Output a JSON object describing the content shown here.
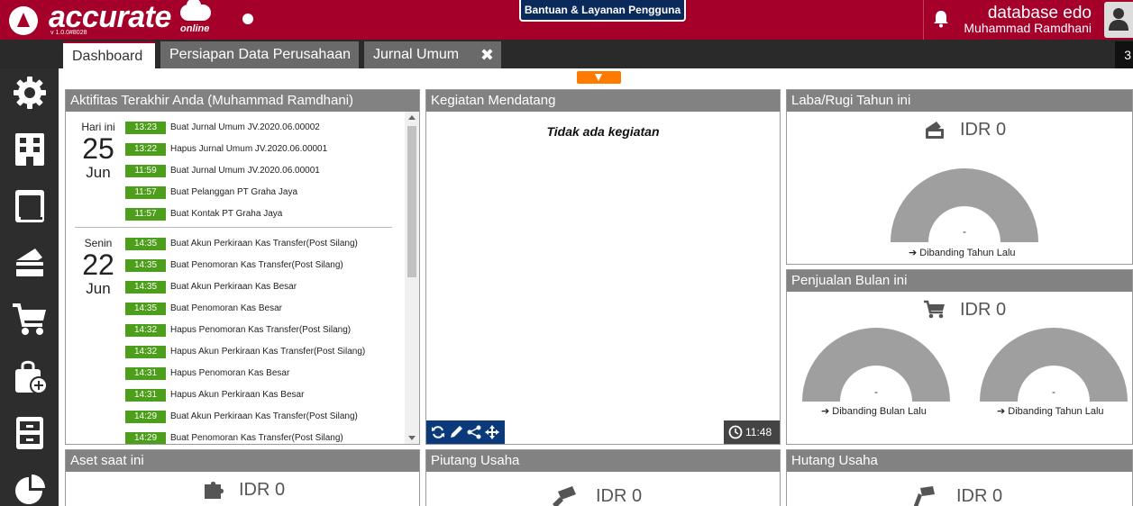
{
  "header": {
    "logo_text": "accurate",
    "logo_online": "online",
    "version": "v 1.0.0#8028",
    "help_button": "Bantuan & Layanan Pengguna",
    "database": "database edo",
    "user": "Muhammad Ramdhani"
  },
  "tabs": [
    {
      "label": "Dashboard",
      "active": true
    },
    {
      "label": "Persiapan Data Perusahaan",
      "active": false
    },
    {
      "label": "Jurnal Umum",
      "active": false,
      "closable": true
    }
  ],
  "tab_overflow": "3",
  "sidebar": {
    "items": [
      {
        "icon": "gear-icon"
      },
      {
        "icon": "building-icon"
      },
      {
        "icon": "book-icon"
      },
      {
        "icon": "payment-icon"
      },
      {
        "icon": "cart-icon"
      },
      {
        "icon": "shopping-bag-add-icon"
      },
      {
        "icon": "inventory-box-icon"
      },
      {
        "icon": "pie-chart-icon"
      }
    ]
  },
  "activity": {
    "title": "Aktifitas Terakhir Anda (Muhammad Ramdhani)",
    "days": [
      {
        "label": "Hari ini",
        "day": "25",
        "month": "Jun",
        "items": [
          {
            "time": "13:23",
            "text": "Buat Jurnal Umum JV.2020.06.00002"
          },
          {
            "time": "13:22",
            "text": "Hapus Jurnal Umum JV.2020.06.00001"
          },
          {
            "time": "11:59",
            "text": "Buat Jurnal Umum JV.2020.06.00001"
          },
          {
            "time": "11:57",
            "text": "Buat Pelanggan PT Graha Jaya"
          },
          {
            "time": "11:57",
            "text": "Buat Kontak PT Graha Jaya"
          }
        ]
      },
      {
        "label": "Senin",
        "day": "22",
        "month": "Jun",
        "items": [
          {
            "time": "14:35",
            "text": "Buat Akun Perkiraan Kas Transfer(Post Silang)"
          },
          {
            "time": "14:35",
            "text": "Buat Penomoran Kas Transfer(Post Silang)"
          },
          {
            "time": "14:35",
            "text": "Buat Akun Perkiraan Kas Besar"
          },
          {
            "time": "14:35",
            "text": "Buat Penomoran Kas Besar"
          },
          {
            "time": "14:32",
            "text": "Hapus Penomoran Kas Transfer(Post Silang)"
          },
          {
            "time": "14:32",
            "text": "Hapus Akun Perkiraan Kas Transfer(Post Silang)"
          },
          {
            "time": "14:31",
            "text": "Hapus Penomoran Kas Besar"
          },
          {
            "time": "14:31",
            "text": "Hapus Akun Perkiraan Kas Besar"
          },
          {
            "time": "14:29",
            "text": "Buat Akun Perkiraan Kas Transfer(Post Silang)"
          },
          {
            "time": "14:29",
            "text": "Buat Penomoran Kas Transfer(Post Silang)"
          }
        ]
      }
    ]
  },
  "kegiatan": {
    "title": "Kegiatan Mendatang",
    "empty_text": "Tidak ada kegiatan",
    "clock": "11:48"
  },
  "laba_rugi": {
    "title": "Laba/Rugi Tahun ini",
    "value": "IDR 0",
    "gauge_value": "-",
    "gauge_label": "Dibanding Tahun Lalu"
  },
  "penjualan": {
    "title": "Penjualan Bulan ini",
    "value": "IDR 0",
    "gauges": [
      {
        "value": "-",
        "label": "Dibanding Bulan Lalu"
      },
      {
        "value": "-",
        "label": "Dibanding Tahun Lalu"
      }
    ]
  },
  "aset": {
    "title": "Aset saat ini",
    "value": "IDR 0"
  },
  "piutang": {
    "title": "Piutang Usaha",
    "value": "IDR 0"
  },
  "hutang": {
    "title": "Hutang Usaha",
    "value": "IDR 0"
  },
  "colors": {
    "header": "#a5002a",
    "time_badge": "#4d9e1b",
    "panel_title": "#828282",
    "gauge": "#9f9f9f",
    "toolbar": "#0b3a7c",
    "collapse": "#ff7a00"
  }
}
